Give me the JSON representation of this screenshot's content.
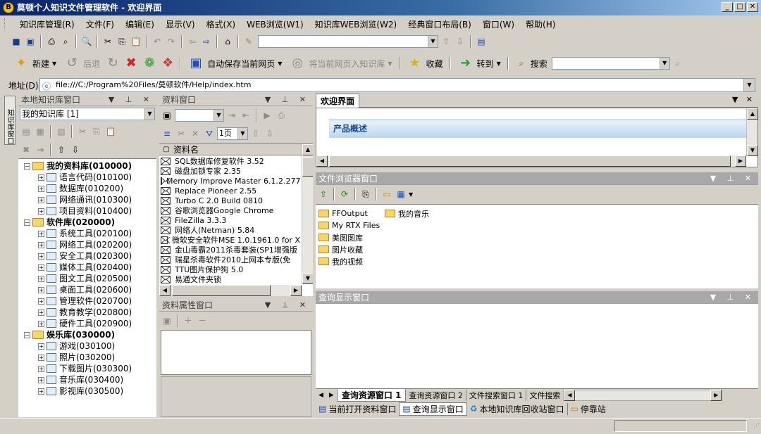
{
  "window": {
    "title": "莫顿个人知识文件管理软件 - 欢迎界面",
    "min": "_",
    "max": "□",
    "close": "✕"
  },
  "menu": [
    "知识库管理(R)",
    "文件(F)",
    "编辑(E)",
    "显示(V)",
    "格式(X)",
    "WEB浏览(W1)",
    "知识库WEB浏览(W2)",
    "经典窗口布局(B)",
    "窗口(W)",
    "帮助(H)"
  ],
  "toolbar2": {
    "new": "新建",
    "back": "后退",
    "autosave": "自动保存当前网页",
    "import": "将当前网页入知识库",
    "fav": "收藏",
    "go": "转到",
    "search": "搜索"
  },
  "address": {
    "label": "地址(D)",
    "url": "file:///C:/Program%20Files/莫顿软件/Help/index.htm"
  },
  "left_pane": {
    "title": "本地知识库窗口",
    "selector": "我的知识库 [1]",
    "side_tab": "知识库窗口",
    "tree": [
      {
        "label": "我的资料库(010000)",
        "level": 0,
        "bold": true
      },
      {
        "label": "语言代码(010100)",
        "level": 1
      },
      {
        "label": "数据库(010200)",
        "level": 1
      },
      {
        "label": "网络通讯(010300)",
        "level": 1
      },
      {
        "label": "项目资料(010400)",
        "level": 1
      },
      {
        "label": "软件库(020000)",
        "level": 0,
        "bold": true
      },
      {
        "label": "系统工具(020100)",
        "level": 1
      },
      {
        "label": "网络工具(020200)",
        "level": 1
      },
      {
        "label": "安全工具(020300)",
        "level": 1
      },
      {
        "label": "媒体工具(020400)",
        "level": 1
      },
      {
        "label": "图文工具(020500)",
        "level": 1
      },
      {
        "label": "桌面工具(020600)",
        "level": 1
      },
      {
        "label": "管理软件(020700)",
        "level": 1
      },
      {
        "label": "教育教学(020800)",
        "level": 1
      },
      {
        "label": "硬件工具(020900)",
        "level": 1
      },
      {
        "label": "娱乐库(030000)",
        "level": 0,
        "bold": true
      },
      {
        "label": "游戏(030100)",
        "level": 1
      },
      {
        "label": "照片(030200)",
        "level": 1
      },
      {
        "label": "下载图片(030300)",
        "level": 1
      },
      {
        "label": "音乐库(030400)",
        "level": 1
      },
      {
        "label": "影视库(030500)",
        "level": 1
      }
    ]
  },
  "resource_pane": {
    "title": "资料窗口",
    "page": "1页",
    "column": "资料名",
    "items": [
      "SQL数据库修复软件 3.52",
      "磁盘加锁专家 2.35",
      "Memory Improve Master 6.1.2.277",
      "Replace Pioneer 2.55",
      "Turbo C 2.0 Build 0810",
      "谷歌浏览器Google Chrome",
      "FileZilla 3.3.3",
      "网络人(Netman) 5.84",
      "微软安全软件MSE 1.0.1961.0 for X",
      "金山毒霸2011杀毒套装(SP1增强版",
      "瑞星杀毒软件2010上网本专版(免",
      "TTU图片保护狗 5.0",
      "易通文件夹锁"
    ]
  },
  "props_pane": {
    "title": "资料属性窗口"
  },
  "welcome": {
    "tab": "欢迎界面",
    "heading": "产品概述"
  },
  "file_browser": {
    "title": "文件浏览器窗口",
    "col1": [
      "FFOutput",
      "My RTX Files",
      "美图图库",
      "图片收藏",
      "我的视频"
    ],
    "col2": [
      "我的音乐"
    ]
  },
  "query_pane": {
    "title": "查询显示窗口",
    "tabs": [
      "查询资源窗口 1",
      "查询资源窗口 2",
      "文件搜索窗口 1",
      "文件搜索"
    ]
  },
  "bottom_tabs": [
    "当前打开资料窗口",
    "查询显示窗口",
    "本地知识库回收站窗口",
    "停靠站"
  ]
}
